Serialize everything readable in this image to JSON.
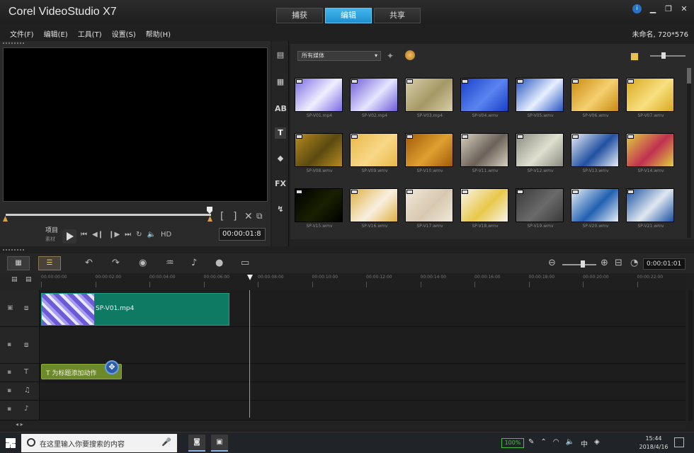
{
  "app": {
    "title": "Corel VideoStudio X7"
  },
  "mode_tabs": [
    {
      "label": "捕获"
    },
    {
      "label": "编辑",
      "active": true
    },
    {
      "label": "共享"
    }
  ],
  "menu": [
    "文件(F)",
    "编辑(E)",
    "工具(T)",
    "设置(S)",
    "帮助(H)"
  ],
  "project_info": "未命名, 720*576",
  "player": {
    "mode_label": "项目",
    "mode_sub": "素材",
    "timecode": "00:00:01:8",
    "hd_label": "HD"
  },
  "library": {
    "folder": "所有媒体",
    "items": [
      {
        "name": "SP-V01.mp4",
        "colors": [
          "#7a6ae0",
          "#f0f0ff"
        ]
      },
      {
        "name": "SP-V02.mp4",
        "colors": [
          "#6d5ad6",
          "#e6e6ff"
        ]
      },
      {
        "name": "SP-V03.mp4",
        "colors": [
          "#d8cfa8",
          "#a59866"
        ]
      },
      {
        "name": "SP-V04.wmv",
        "colors": [
          "#1740c8",
          "#5b84f0"
        ]
      },
      {
        "name": "SP-V05.wmv",
        "colors": [
          "#2454c0",
          "#e8f0ff"
        ]
      },
      {
        "name": "SP-V06.wmv",
        "colors": [
          "#c88a10",
          "#f5d070"
        ]
      },
      {
        "name": "SP-V07.wmv",
        "colors": [
          "#d9a820",
          "#f8e080"
        ]
      },
      {
        "name": "SP-V08.wmv",
        "colors": [
          "#b88a20",
          "#5a4a10"
        ]
      },
      {
        "name": "SP-V09.wmv",
        "colors": [
          "#e8b848",
          "#f8d888"
        ]
      },
      {
        "name": "SP-V10.wmv",
        "colors": [
          "#a05a08",
          "#e0a030"
        ]
      },
      {
        "name": "SP-V11.wmv",
        "colors": [
          "#d8d0c0",
          "#6a6058"
        ]
      },
      {
        "name": "SP-V12.wmv",
        "colors": [
          "#8a8a80",
          "#e0e0d0"
        ]
      },
      {
        "name": "SP-V13.wmv",
        "colors": [
          "#e8eef8",
          "#2050a0"
        ]
      },
      {
        "name": "SP-V14.wmv",
        "colors": [
          "#e0d040",
          "#c03050"
        ]
      },
      {
        "name": "SP-V15.wmv",
        "colors": [
          "#000000",
          "#182000"
        ]
      },
      {
        "name": "SP-V16.wmv",
        "colors": [
          "#e0b040",
          "#f8f0e0"
        ]
      },
      {
        "name": "SP-V17.wmv",
        "colors": [
          "#f0e8d8",
          "#d8c8b0"
        ]
      },
      {
        "name": "SP-V18.wmv",
        "colors": [
          "#f8f4ea",
          "#e8c84a"
        ]
      },
      {
        "name": "SP-V19.wmv",
        "colors": [
          "#3a3a3a",
          "#6a6a6a"
        ]
      },
      {
        "name": "SP-V20.wmv",
        "colors": [
          "#e8f0f8",
          "#2060b0"
        ]
      },
      {
        "name": "SP-V21.wmv",
        "colors": [
          "#1850a0",
          "#e0e8f0"
        ]
      }
    ]
  },
  "timeline": {
    "timecode": "0:00:01:01",
    "ruler": [
      "00:00:00:00",
      "00:00:02:00",
      "00:00:04:00",
      "00:00:06:00",
      "00:00:08:00",
      "00:00:10:00",
      "00:00:12:00",
      "00:00:14:00",
      "00:00:16:00",
      "00:00:18:00",
      "00:00:20:00",
      "00:00:22:00"
    ],
    "video_clip": "SP-V01.mp4",
    "title_clip": "T 为标题添加动作"
  },
  "taskbar": {
    "search_placeholder": "在这里输入你要搜索的内容",
    "battery": "100%",
    "ime": "中",
    "time": "15:44",
    "date": "2018/4/16"
  }
}
